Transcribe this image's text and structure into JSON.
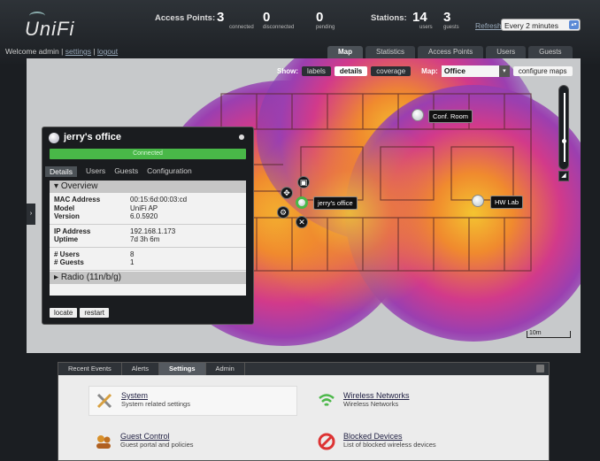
{
  "brand": {
    "logo": "UniFi"
  },
  "stats": {
    "access_points_label": "Access Points:",
    "ap": [
      {
        "value": "3",
        "label": "connected"
      },
      {
        "value": "0",
        "label": "disconnected"
      },
      {
        "value": "0",
        "label": "pending"
      }
    ],
    "stations_label": "Stations:",
    "stations": [
      {
        "value": "14",
        "label": "users"
      },
      {
        "value": "3",
        "label": "guests"
      }
    ]
  },
  "refresh": {
    "link": "Refresh",
    "selected": "Every 2 minutes"
  },
  "welcome": {
    "text": "Welcome admin",
    "settings": "settings",
    "logout": "logout"
  },
  "tabs": [
    "Map",
    "Statistics",
    "Access Points",
    "Users",
    "Guests"
  ],
  "map_toolbar": {
    "show_label": "Show:",
    "buttons": [
      "labels",
      "details",
      "coverage"
    ],
    "map_label": "Map:",
    "map_selected": "Office",
    "configure": "configure maps"
  },
  "aps": [
    {
      "name": "Conf. Room"
    },
    {
      "name": "jerry's office"
    },
    {
      "name": "HW Lab"
    }
  ],
  "scale_label": "10m",
  "panel": {
    "title": "jerry's office",
    "status": "Connected",
    "tabs": [
      "Details",
      "Users",
      "Guests",
      "Configuration"
    ],
    "section": "Overview",
    "groups": [
      [
        {
          "k": "MAC Address",
          "v": "00:15:6d:00:03:cd"
        },
        {
          "k": "Model",
          "v": "UniFi AP"
        },
        {
          "k": "Version",
          "v": "6.0.5920"
        }
      ],
      [
        {
          "k": "IP Address",
          "v": "192.168.1.173"
        },
        {
          "k": "Uptime",
          "v": "7d 3h 6m"
        }
      ],
      [
        {
          "k": "# Users",
          "v": "8"
        },
        {
          "k": "# Guests",
          "v": "1"
        }
      ]
    ],
    "radio": "Radio (11n/b/g)",
    "buttons": [
      "locate",
      "restart"
    ]
  },
  "settings_panel": {
    "tabs": [
      "Recent Events",
      "Alerts",
      "Settings",
      "Admin"
    ],
    "active_tab": "Settings",
    "items": [
      {
        "title": "System",
        "desc": "System related settings"
      },
      {
        "title": "Wireless Networks",
        "desc": "Wireless Networks"
      },
      {
        "title": "Guest Control",
        "desc": "Guest portal and policies"
      },
      {
        "title": "Blocked Devices",
        "desc": "List of blocked wireless devices"
      }
    ]
  },
  "colors": {
    "connected": "#49b848",
    "heat_hot": "#f4c430",
    "heat_mid": "#d23a8a",
    "heat_outer": "#7d3fb6"
  }
}
